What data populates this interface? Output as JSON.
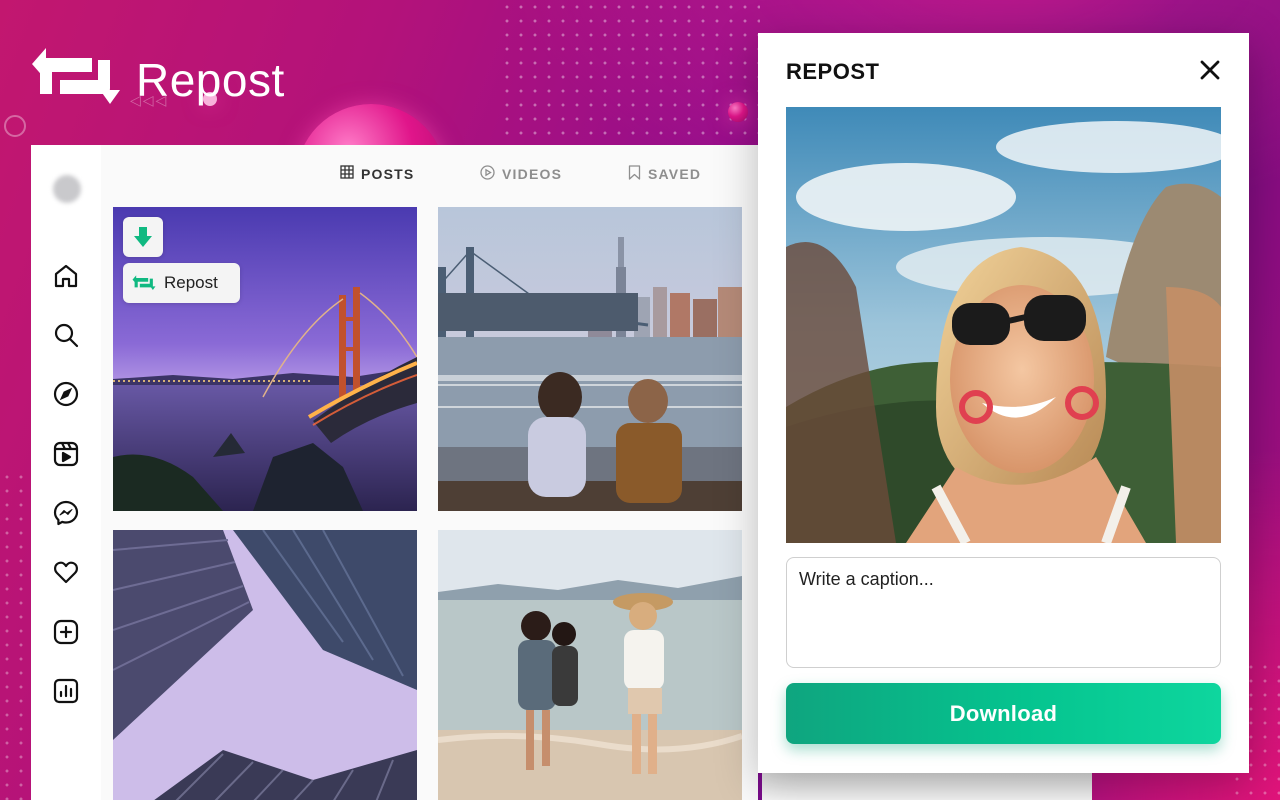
{
  "brand": {
    "title": "Repost"
  },
  "feed": {
    "tabs": [
      {
        "label": "POSTS",
        "icon": "grid-icon",
        "active": true
      },
      {
        "label": "VIDEOS",
        "icon": "play-circle-icon",
        "active": false
      },
      {
        "label": "SAVED",
        "icon": "bookmark-icon",
        "active": false
      }
    ],
    "sidebar_icons": [
      "home-icon",
      "search-icon",
      "compass-icon",
      "reels-icon",
      "messenger-icon",
      "heart-icon",
      "create-icon",
      "insights-icon"
    ],
    "repost_chip_label": "Repost",
    "posts": [
      {
        "scene": "golden-gate-bridge-at-dusk"
      },
      {
        "scene": "couple-on-waterfront-bench-city-skyline"
      },
      {
        "scene": "glass-skyscrapers-from-below"
      },
      {
        "scene": "friends-walking-on-beach"
      }
    ]
  },
  "modal": {
    "title": "REPOST",
    "preview_scene": "woman-selfie-sunglasses-mountain",
    "caption_placeholder": "Write a caption...",
    "download_label": "Download"
  },
  "colors": {
    "download_start": "#0fa57f",
    "download_end": "#0ed69e",
    "accent_green": "#10b981",
    "bg_magenta": "#b3127a"
  }
}
